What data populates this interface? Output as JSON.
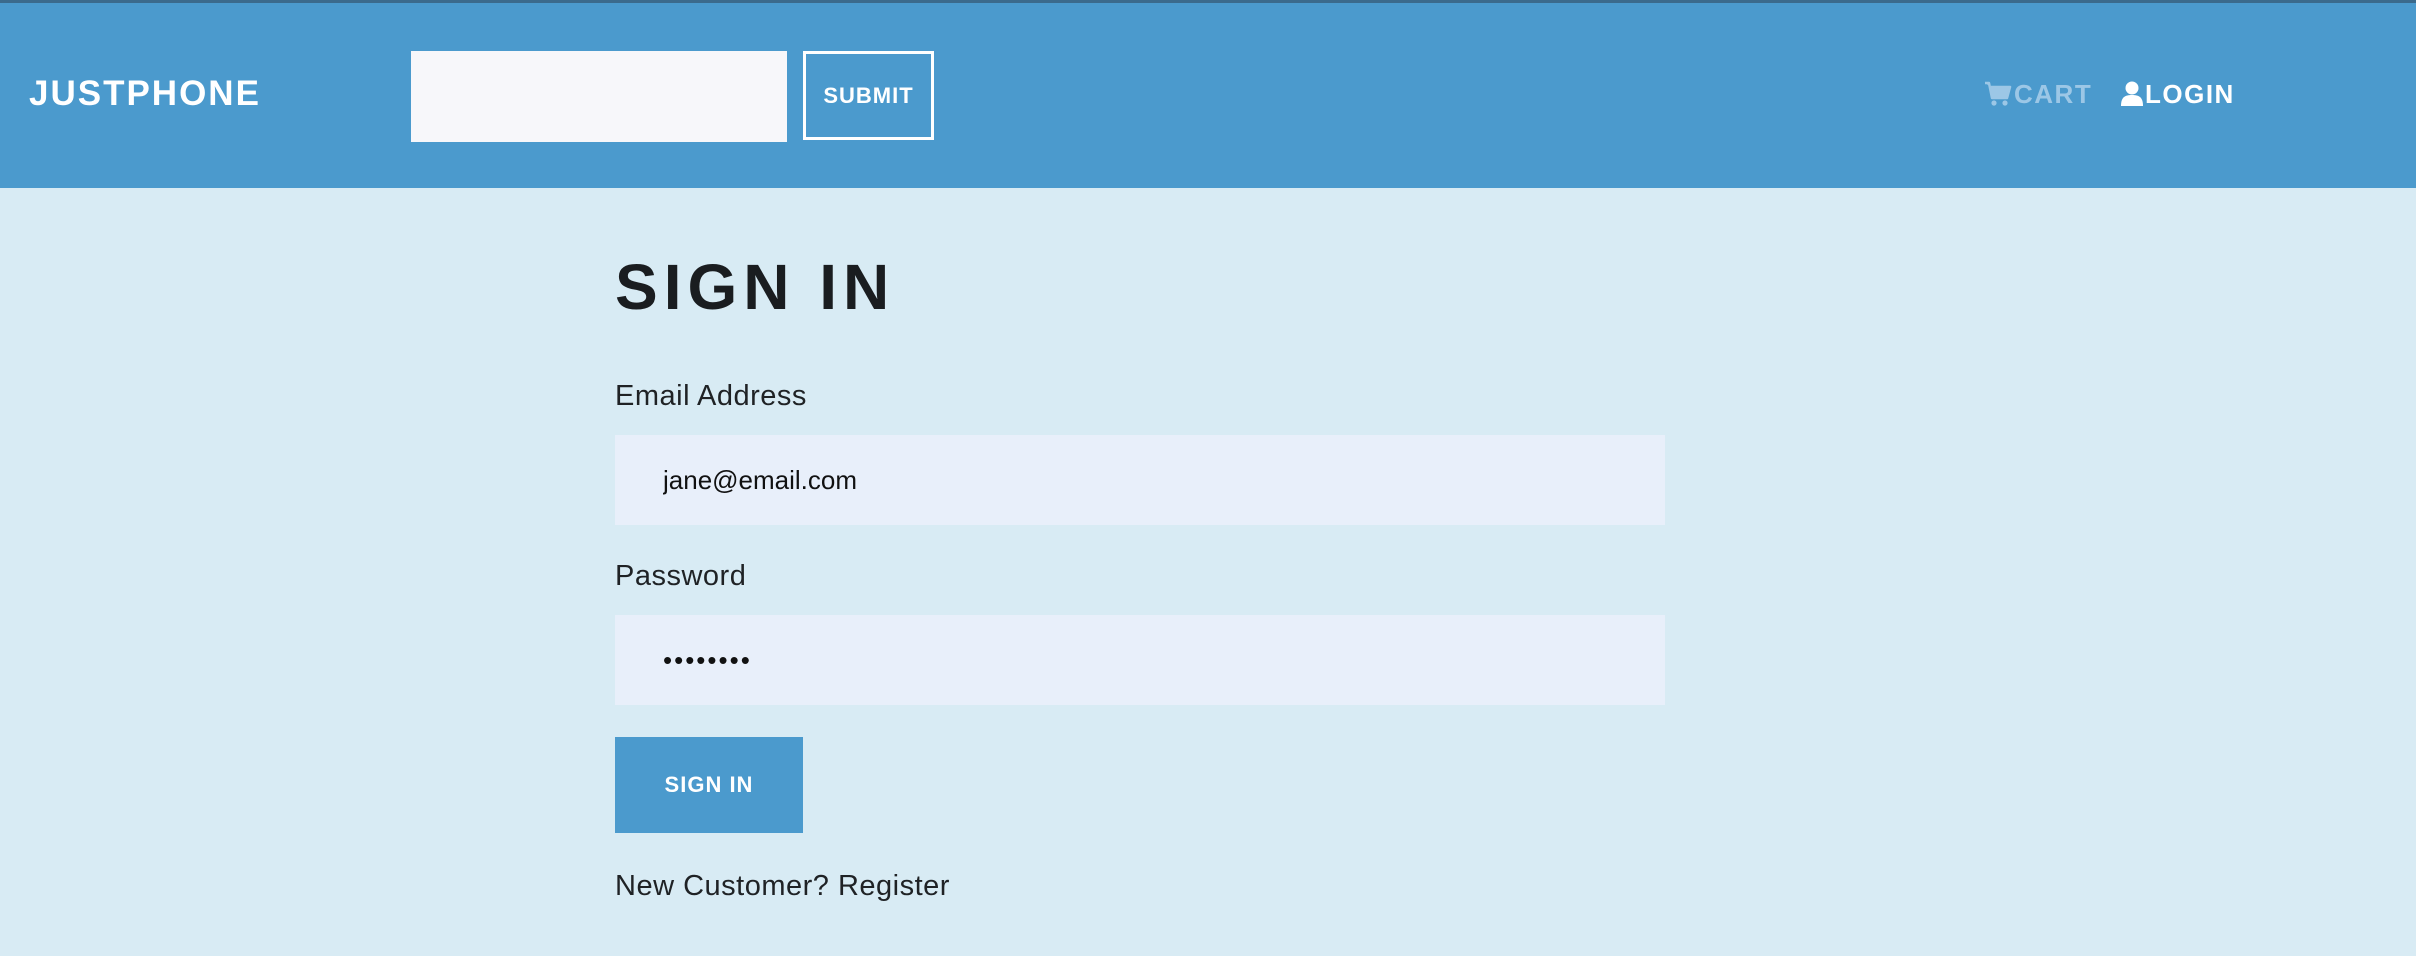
{
  "header": {
    "brand": "JUSTPHONE",
    "search": {
      "placeholder": "",
      "value": ""
    },
    "submit_label": "SUBMIT",
    "nav": {
      "cart_label": "CART",
      "cart_icon": "cart-icon",
      "login_label": "LOGIN",
      "login_icon": "user-icon"
    }
  },
  "form": {
    "title": "SIGN IN",
    "email_label": "Email Address",
    "email_value": "jane@email.com",
    "password_label": "Password",
    "password_value": "••••••••",
    "submit_label": "SIGN IN",
    "register_prompt": "New Customer?",
    "register_link": "Register"
  },
  "colors": {
    "header_bg": "#4b9acd",
    "page_bg": "#d8ebf4",
    "input_bg": "#e8effa",
    "cart_link": "#9cc7e6"
  }
}
